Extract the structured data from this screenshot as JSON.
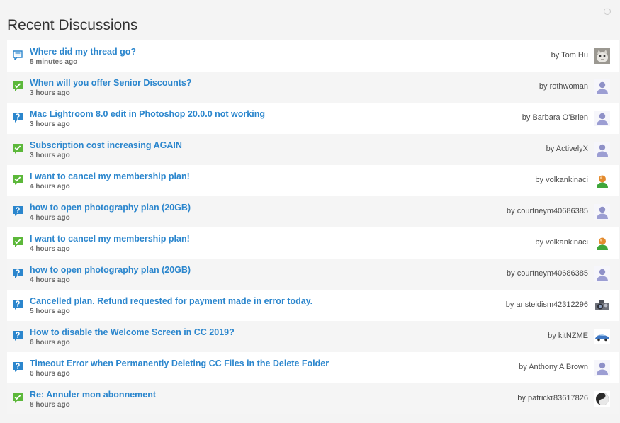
{
  "page": {
    "title": "Recent Discussions"
  },
  "colors": {
    "link": "#2b86cd",
    "answered": "#5cb83a",
    "question": "#2b86cd"
  },
  "discussions": [
    {
      "title": "Where did my thread go?",
      "time": "5 minutes ago",
      "by_prefix": "by",
      "author": "Tom Hu",
      "status_icon": "discussion-icon",
      "avatar": "cat-photo"
    },
    {
      "title": "When will you offer Senior Discounts?",
      "time": "3 hours ago",
      "by_prefix": "by",
      "author": "rothwoman",
      "status_icon": "answered-check-icon",
      "avatar": "default-user"
    },
    {
      "title": "Mac Lightroom 8.0 edit in Photoshop 20.0.0 not working",
      "time": "3 hours ago",
      "by_prefix": "by",
      "author": "Barbara O'Brien",
      "status_icon": "question-icon",
      "avatar": "default-user"
    },
    {
      "title": "Subscription cost increasing AGAIN",
      "time": "3 hours ago",
      "by_prefix": "by",
      "author": "ActivelyX",
      "status_icon": "answered-check-icon",
      "avatar": "default-user"
    },
    {
      "title": "I want to cancel my membership plan!",
      "time": "4 hours ago",
      "by_prefix": "by",
      "author": "volkankinaci",
      "status_icon": "answered-check-icon",
      "avatar": "green-user"
    },
    {
      "title": "how to open photography plan (20GB)",
      "time": "4 hours ago",
      "by_prefix": "by",
      "author": "courtneym40686385",
      "status_icon": "question-icon",
      "avatar": "default-user"
    },
    {
      "title": "I want to cancel my membership plan!",
      "time": "4 hours ago",
      "by_prefix": "by",
      "author": "volkankinaci",
      "status_icon": "answered-check-icon",
      "avatar": "green-user"
    },
    {
      "title": "how to open photography plan (20GB)",
      "time": "4 hours ago",
      "by_prefix": "by",
      "author": "courtneym40686385",
      "status_icon": "question-icon",
      "avatar": "default-user"
    },
    {
      "title": "Cancelled plan. Refund requested for payment made in error today.",
      "time": "5 hours ago",
      "by_prefix": "by",
      "author": "aristeidism42312296",
      "status_icon": "question-icon",
      "avatar": "camera"
    },
    {
      "title": "How to disable the Welcome Screen in CC 2019?",
      "time": "6 hours ago",
      "by_prefix": "by",
      "author": "kitNZME",
      "status_icon": "question-icon",
      "avatar": "car"
    },
    {
      "title": "Timeout Error when Permanently Deleting CC Files in the Delete Folder",
      "time": "6 hours ago",
      "by_prefix": "by",
      "author": "Anthony A Brown",
      "status_icon": "question-icon",
      "avatar": "default-user"
    },
    {
      "title": "Re: Annuler mon abonnement",
      "time": "8 hours ago",
      "by_prefix": "by",
      "author": "patrickr83617826",
      "status_icon": "answered-check-icon",
      "avatar": "yin-yang"
    }
  ]
}
